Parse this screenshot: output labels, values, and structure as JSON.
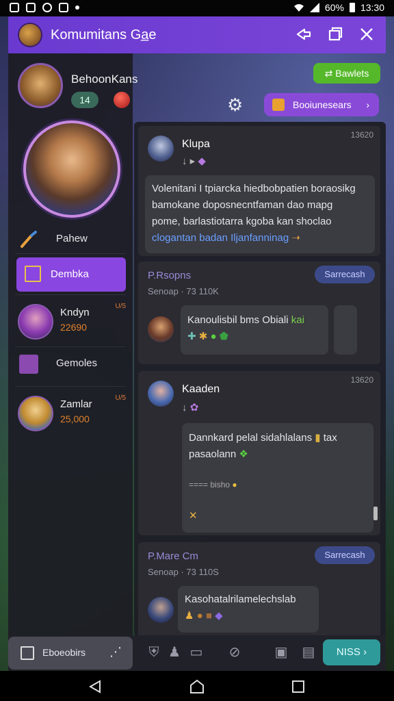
{
  "status_bar": {
    "time": "13:30",
    "battery": "60%"
  },
  "header": {
    "title": "Komumitans Ga̲e"
  },
  "profile": {
    "name": "BehoonKans",
    "level": "14"
  },
  "buttons": {
    "green": "Bawlets",
    "purple": "Booiunesears"
  },
  "sidebar": {
    "menu_paint": "Pahew",
    "menu_active": "Dembka",
    "friends": [
      {
        "name": "Kndyn",
        "score": "22690",
        "tag": "U/5"
      },
      {
        "name": "Zamlar",
        "score": "25,000",
        "tag": "U/5"
      }
    ],
    "menu_profile": "Gemoles"
  },
  "feed": {
    "card1": {
      "name": "Klupa",
      "time": "13620",
      "text_lines": [
        "Volenitani I tpiarcka hiedbobpatien boraosikg",
        "bamokane doposnecntfaman dao mapg",
        "pome, barlastiotarra kgoba kan shoclao"
      ],
      "link": "clogantan badan Iljanfanninag"
    },
    "card2": {
      "head": "P.Rsopns",
      "badge": "Sarrecash",
      "sub": "Senoap · 73 110K",
      "bubble": "Kanoulisbil bms Obiali",
      "bubble_accent": "kai"
    },
    "card3": {
      "name": "Kaaden",
      "time": "13620",
      "bubble_lines": [
        "Dannkard pelal sidahlalans",
        "pasaolann"
      ],
      "bubble_tail": "tax",
      "mini": "====  bisho"
    },
    "card4": {
      "head": "P.Mare Cm",
      "badge": "Sarrecash",
      "sub": "Senoap · 73 110S",
      "bubble": "Kasohatalrilamelechslab"
    }
  },
  "bottom_bar": {
    "left_label": "Eboeobirs",
    "next_label": "NISS"
  },
  "colors": {
    "accent_purple": "#7b45d8",
    "green": "#55b82a",
    "teal": "#2f9a9a"
  }
}
